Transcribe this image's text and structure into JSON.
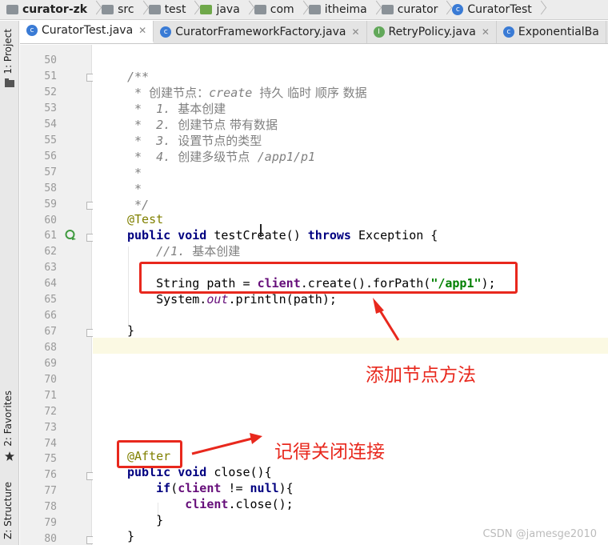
{
  "breadcrumb": [
    {
      "label": "curator-zk",
      "icon": "module-folder-icon",
      "bold": true
    },
    {
      "label": "src",
      "icon": "folder-icon"
    },
    {
      "label": "test",
      "icon": "folder-icon"
    },
    {
      "label": "java",
      "icon": "source-folder-icon"
    },
    {
      "label": "com",
      "icon": "folder-icon"
    },
    {
      "label": "itheima",
      "icon": "folder-icon"
    },
    {
      "label": "curator",
      "icon": "folder-icon"
    },
    {
      "label": "CuratorTest",
      "icon": "class-icon"
    }
  ],
  "tool_windows": {
    "project": "1: Project",
    "favorites": "2: Favorites",
    "structure": "Z: Structure"
  },
  "tabs": [
    {
      "label": "CuratorTest.java",
      "icon": "class-icon",
      "active": true
    },
    {
      "label": "CuratorFrameworkFactory.java",
      "icon": "class-icon",
      "active": false
    },
    {
      "label": "RetryPolicy.java",
      "icon": "interface-icon",
      "active": false
    },
    {
      "label": "ExponentialBa",
      "icon": "class-icon",
      "active": false
    }
  ],
  "line_numbers": [
    "50",
    "51",
    "52",
    "53",
    "54",
    "55",
    "56",
    "57",
    "58",
    "59",
    "60",
    "61",
    "62",
    "63",
    "64",
    "65",
    "66",
    "67",
    "68",
    "69",
    "70",
    "71",
    "72",
    "73",
    "74",
    "75",
    "76",
    "77",
    "78",
    "79",
    "80"
  ],
  "code": {
    "l51": "/**",
    "l52_a": " * ",
    "l52_b": "创建节点：",
    "l52_c": "create ",
    "l52_d": "持久 临时 顺序 数据",
    "l53_a": " *  1. ",
    "l53_b": "基本创建",
    "l54_a": " *  2. ",
    "l54_b": "创建节点 带有数据",
    "l55_a": " *  3. ",
    "l55_b": "设置节点的类型",
    "l56_a": " *  4. ",
    "l56_b": "创建多级节点  ",
    "l56_c": "/app1/p1",
    "l57": " *",
    "l58": " *",
    "l59": " */",
    "l60": "@Test",
    "l61_kw1": "public",
    "l61_kw2": "void",
    "l61_name": " testCreate() ",
    "l61_kw3": "throws",
    "l61_rest": " Exception {",
    "l62_a": "    //1. ",
    "l62_b": "基本创建",
    "l64_a": "    String path = ",
    "l64_fld": "client",
    "l64_b": ".create().forPath(",
    "l64_str": "\"/app1\"",
    "l64_c": ");",
    "l65_a": "    System.",
    "l65_out": "out",
    "l65_b": ".println(path);",
    "l67": "}",
    "l75": "@After",
    "l76_kw1": "public",
    "l76_kw2": "void",
    "l76_rest": " close(){",
    "l77_kw": "if",
    "l77_a": "(",
    "l77_fld": "client",
    "l77_b": " != ",
    "l77_null": "null",
    "l77_c": "){",
    "l78_fld": "client",
    "l78_rest": ".close();",
    "l79": "    }",
    "l80": "}"
  },
  "annotations": {
    "add_node_method": "添加节点方法",
    "remember_close": "记得关闭连接"
  },
  "watermark": "CSDN @jamesge2010",
  "colors": {
    "annotation_red": "#e8281d",
    "keyword": "#000080",
    "string": "#008000",
    "annotation": "#808000",
    "field": "#660e7a",
    "comment": "#808080"
  }
}
